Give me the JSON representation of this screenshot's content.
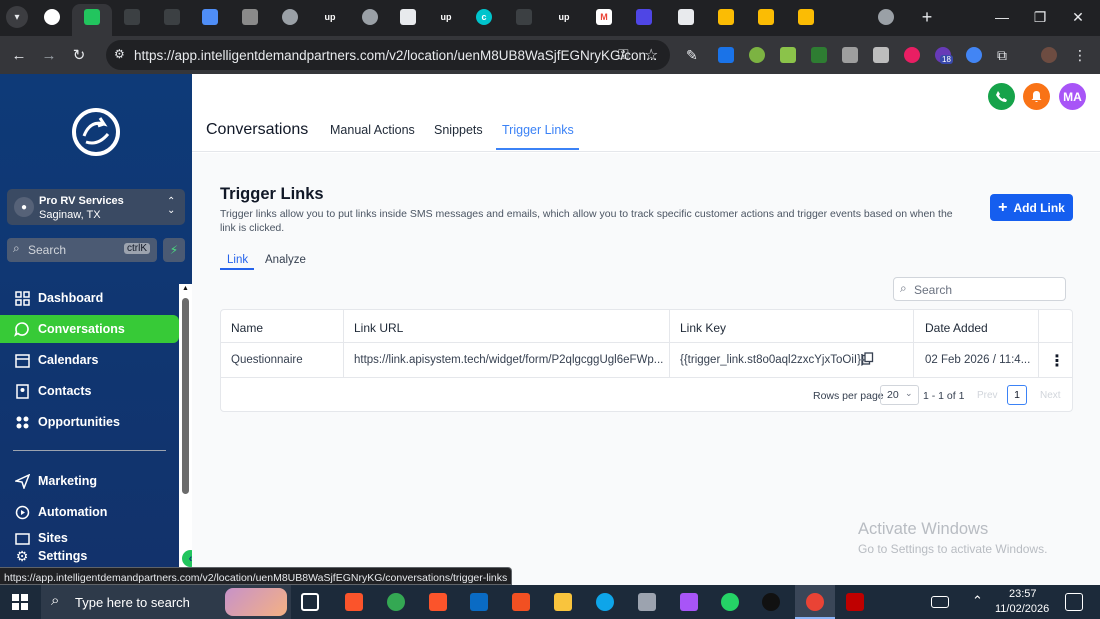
{
  "browser": {
    "url": "https://app.intelligentdemandpartners.com/v2/location/uenM8UB8WaSjfEGNryKG/con...",
    "status_url": "https://app.intelligentdemandpartners.com/v2/location/uenM8UB8WaSjfEGNryKG/conversations/trigger-links",
    "extension_badge": "18",
    "tabs": [
      {
        "icon": "chatgpt-icon",
        "label": ""
      },
      {
        "icon": "green-app-icon",
        "label": ""
      },
      {
        "icon": "monitor-icon",
        "label": ""
      },
      {
        "icon": "monitor-icon",
        "label": ""
      },
      {
        "icon": "gemini-icon",
        "label": ""
      },
      {
        "icon": "gray-doc-icon",
        "label": ""
      },
      {
        "icon": "globe-icon",
        "label": ""
      },
      {
        "icon": "upwork-icon",
        "label": "up"
      },
      {
        "icon": "globe-icon",
        "label": ""
      },
      {
        "icon": "docs-icon",
        "label": ""
      },
      {
        "icon": "upwork-icon",
        "label": "up"
      },
      {
        "icon": "canva-icon",
        "label": "c"
      },
      {
        "icon": "monitor-icon",
        "label": ""
      },
      {
        "icon": "upwork-icon",
        "label": "up"
      },
      {
        "icon": "gmail-icon",
        "label": "M"
      },
      {
        "icon": "pen-icon",
        "label": ""
      },
      {
        "icon": "docs-icon",
        "label": ""
      },
      {
        "icon": "drive-icon",
        "label": ""
      },
      {
        "icon": "drive-icon",
        "label": ""
      },
      {
        "icon": "drive-icon",
        "label": ""
      },
      {
        "icon": "globe-icon",
        "label": ""
      }
    ]
  },
  "sidebar": {
    "account": {
      "name": "Pro RV Services",
      "location": "Saginaw, TX"
    },
    "search": {
      "placeholder": "Search",
      "shortcut": "ctrlK"
    },
    "items": [
      {
        "label": "Dashboard",
        "icon": "dashboard-icon"
      },
      {
        "label": "Conversations",
        "icon": "chat-icon",
        "active": true
      },
      {
        "label": "Calendars",
        "icon": "calendar-icon"
      },
      {
        "label": "Contacts",
        "icon": "contacts-icon"
      },
      {
        "label": "Opportunities",
        "icon": "opportunities-icon"
      },
      {
        "label": "Marketing",
        "icon": "send-icon"
      },
      {
        "label": "Automation",
        "icon": "automation-icon"
      },
      {
        "label": "Sites",
        "icon": "sites-icon"
      },
      {
        "label": "Settings",
        "icon": "gear-icon"
      }
    ]
  },
  "header": {
    "title": "Conversations",
    "tabs": [
      "Manual Actions",
      "Snippets",
      "Trigger Links"
    ],
    "active_tab": "Trigger Links",
    "avatar": "MA",
    "colors": {
      "phone": "#16a34a",
      "bell": "#f97316",
      "avatar": "#a855f7",
      "accent": "#2563eb"
    }
  },
  "page": {
    "title": "Trigger Links",
    "description": "Trigger links allow you to put links inside SMS messages and emails, which allow you to track specific customer actions and trigger events based on when the link is clicked.",
    "add_button": "Add Link",
    "subtabs": [
      "Link",
      "Analyze"
    ],
    "search_placeholder": "Search",
    "table": {
      "columns": [
        "Name",
        "Link URL",
        "Link Key",
        "Date Added"
      ],
      "rows": [
        {
          "name": "Questionnaire",
          "url": "https://link.apisystem.tech/widget/form/P2qlgcggUgl6eFWp...",
          "key": "{{trigger_link.st8o0aql2zxcYjxToOiI}}",
          "date": "02 Feb 2026 / 11:4..."
        }
      ]
    },
    "pagination": {
      "rows_label": "Rows per page",
      "rows_value": "20",
      "range": "1 - 1 of 1",
      "prev": "Prev",
      "page": "1",
      "next": "Next"
    }
  },
  "watermark": {
    "title": "Activate Windows",
    "subtitle": "Go to Settings to activate Windows."
  },
  "taskbar": {
    "search_placeholder": "Type here to search",
    "time": "23:57",
    "date": "11/02/2026"
  }
}
